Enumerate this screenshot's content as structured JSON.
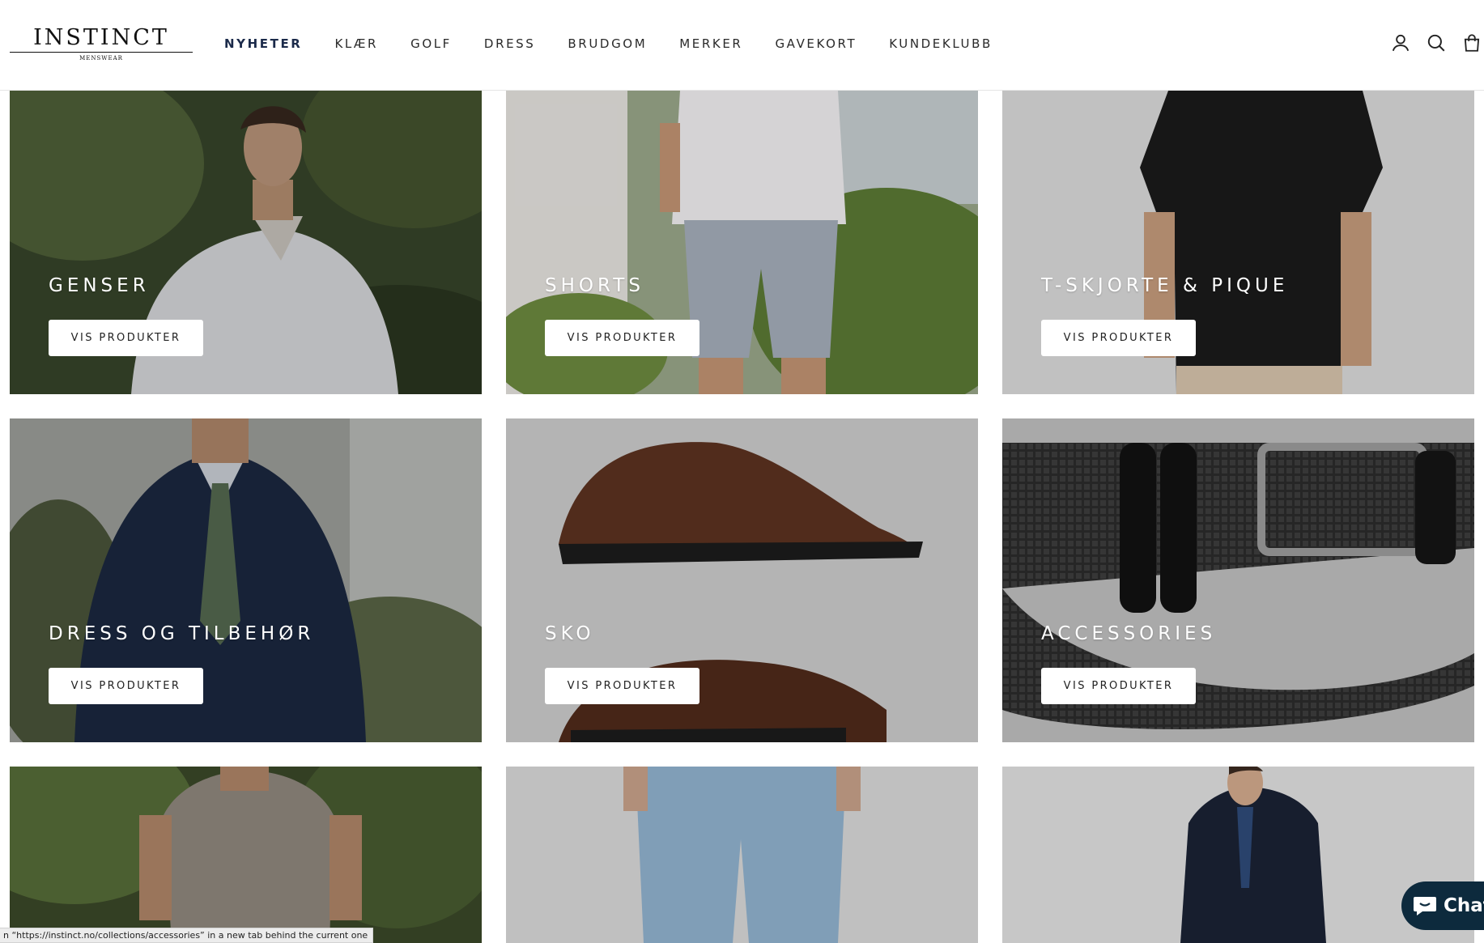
{
  "header": {
    "logo": {
      "word": "INSTINCT",
      "sub": "MENSWEAR"
    },
    "nav": [
      {
        "label": "NYHETER",
        "active": true
      },
      {
        "label": "KLÆR"
      },
      {
        "label": "GOLF"
      },
      {
        "label": "DRESS"
      },
      {
        "label": "BRUDGOM"
      },
      {
        "label": "MERKER"
      },
      {
        "label": "GAVEKORT"
      },
      {
        "label": "KUNDEKLUBB"
      }
    ],
    "icons": [
      "account-icon",
      "search-icon",
      "cart-icon"
    ]
  },
  "tiles": [
    {
      "title": "GENSER",
      "button": "VIS PRODUKTER"
    },
    {
      "title": "SHORTS",
      "button": "VIS PRODUKTER"
    },
    {
      "title": "T-SKJORTE & PIQUE",
      "button": "VIS PRODUKTER"
    },
    {
      "title": "DRESS OG TILBEHØR",
      "button": "VIS PRODUKTER"
    },
    {
      "title": "SKO",
      "button": "VIS PRODUKTER"
    },
    {
      "title": "ACCESSORIES",
      "button": "VIS PRODUKTER"
    },
    {
      "title": "",
      "button": ""
    },
    {
      "title": "",
      "button": ""
    },
    {
      "title": "",
      "button": ""
    }
  ],
  "status_bar": {
    "text": "n “https://instinct.no/collections/accessories” in a new tab behind the current one"
  },
  "chat": {
    "label": "Chat"
  },
  "colors": {
    "nav_active": "#1b2a4a",
    "chat_bg": "#0d2a3d"
  }
}
